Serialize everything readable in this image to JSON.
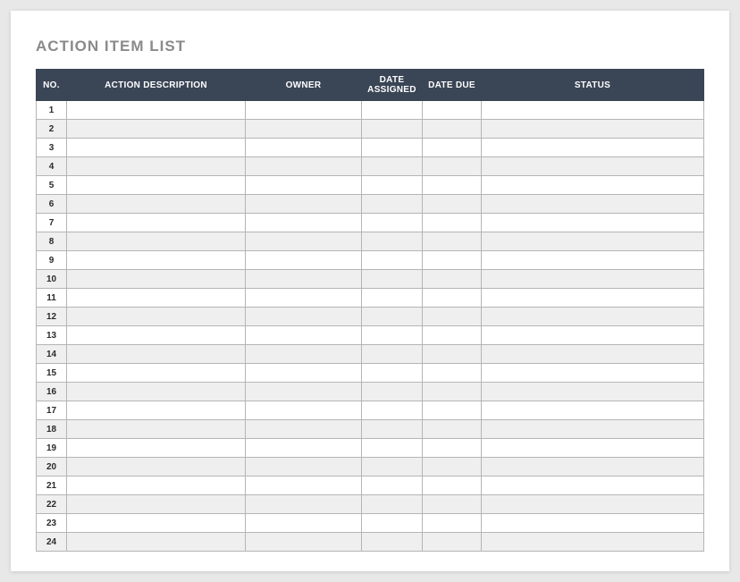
{
  "title": "ACTION ITEM LIST",
  "columns": {
    "no": "NO.",
    "description": "ACTION DESCRIPTION",
    "owner": "OWNER",
    "assigned": "DATE ASSIGNED",
    "due": "DATE DUE",
    "status": "STATUS"
  },
  "rows": [
    {
      "no": "1",
      "description": "",
      "owner": "",
      "assigned": "",
      "due": "",
      "status": ""
    },
    {
      "no": "2",
      "description": "",
      "owner": "",
      "assigned": "",
      "due": "",
      "status": ""
    },
    {
      "no": "3",
      "description": "",
      "owner": "",
      "assigned": "",
      "due": "",
      "status": ""
    },
    {
      "no": "4",
      "description": "",
      "owner": "",
      "assigned": "",
      "due": "",
      "status": ""
    },
    {
      "no": "5",
      "description": "",
      "owner": "",
      "assigned": "",
      "due": "",
      "status": ""
    },
    {
      "no": "6",
      "description": "",
      "owner": "",
      "assigned": "",
      "due": "",
      "status": ""
    },
    {
      "no": "7",
      "description": "",
      "owner": "",
      "assigned": "",
      "due": "",
      "status": ""
    },
    {
      "no": "8",
      "description": "",
      "owner": "",
      "assigned": "",
      "due": "",
      "status": ""
    },
    {
      "no": "9",
      "description": "",
      "owner": "",
      "assigned": "",
      "due": "",
      "status": ""
    },
    {
      "no": "10",
      "description": "",
      "owner": "",
      "assigned": "",
      "due": "",
      "status": ""
    },
    {
      "no": "11",
      "description": "",
      "owner": "",
      "assigned": "",
      "due": "",
      "status": ""
    },
    {
      "no": "12",
      "description": "",
      "owner": "",
      "assigned": "",
      "due": "",
      "status": ""
    },
    {
      "no": "13",
      "description": "",
      "owner": "",
      "assigned": "",
      "due": "",
      "status": ""
    },
    {
      "no": "14",
      "description": "",
      "owner": "",
      "assigned": "",
      "due": "",
      "status": ""
    },
    {
      "no": "15",
      "description": "",
      "owner": "",
      "assigned": "",
      "due": "",
      "status": ""
    },
    {
      "no": "16",
      "description": "",
      "owner": "",
      "assigned": "",
      "due": "",
      "status": ""
    },
    {
      "no": "17",
      "description": "",
      "owner": "",
      "assigned": "",
      "due": "",
      "status": ""
    },
    {
      "no": "18",
      "description": "",
      "owner": "",
      "assigned": "",
      "due": "",
      "status": ""
    },
    {
      "no": "19",
      "description": "",
      "owner": "",
      "assigned": "",
      "due": "",
      "status": ""
    },
    {
      "no": "20",
      "description": "",
      "owner": "",
      "assigned": "",
      "due": "",
      "status": ""
    },
    {
      "no": "21",
      "description": "",
      "owner": "",
      "assigned": "",
      "due": "",
      "status": ""
    },
    {
      "no": "22",
      "description": "",
      "owner": "",
      "assigned": "",
      "due": "",
      "status": ""
    },
    {
      "no": "23",
      "description": "",
      "owner": "",
      "assigned": "",
      "due": "",
      "status": ""
    },
    {
      "no": "24",
      "description": "",
      "owner": "",
      "assigned": "",
      "due": "",
      "status": ""
    }
  ]
}
